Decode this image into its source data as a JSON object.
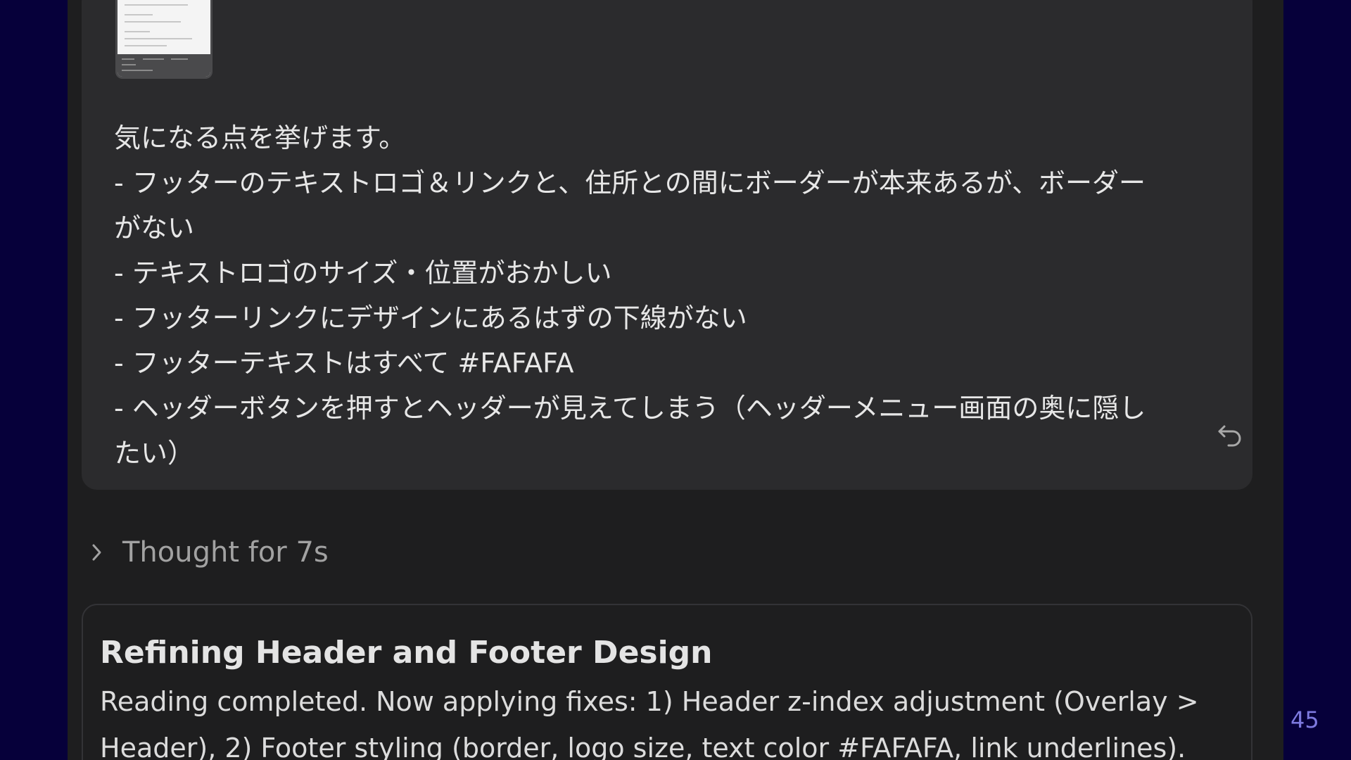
{
  "user_message": {
    "lines": [
      "気になる点を挙げます。",
      "- フッターのテキストロゴ＆リンクと、住所との間にボーダーが本来あるが、ボーダー",
      "がない",
      "- テキストロゴのサイズ・位置がおかしい",
      "- フッターリンクにデザインにあるはずの下線がない",
      "- フッターテキストはすべて #FAFAFA",
      "- ヘッダーボタンを押すとヘッダーが見えてしまう（ヘッダーメニュー画面の奥に隠し",
      "たい）"
    ]
  },
  "thought": {
    "label": "Thought for 7s"
  },
  "card": {
    "title": "Refining Header and Footer Design",
    "body": "Reading completed. Now applying fixes: 1) Header z-index adjustment (Overlay > Header), 2) Footer styling (border, logo size, text color #FAFAFA, link underlines)."
  },
  "page_number": "45",
  "colors": {
    "page_background": "#06003a",
    "panel": "#1e1e1f",
    "bubble": "#2b2b2d",
    "page_number": "#7e7ae0"
  },
  "icons": {
    "attachment": "image-thumbnail",
    "retry": "undo-arrow-icon",
    "expand": "chevron-right-icon"
  }
}
